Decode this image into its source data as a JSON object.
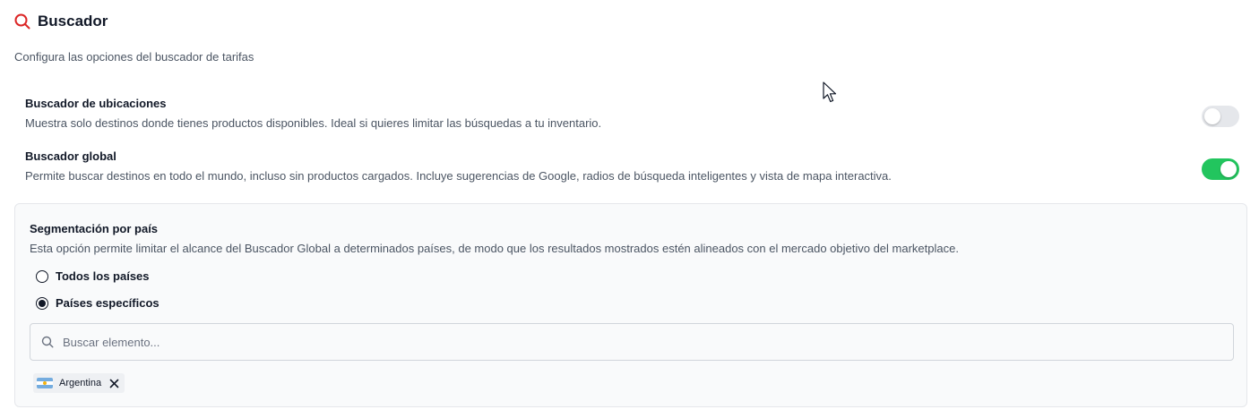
{
  "header": {
    "title": "Buscador",
    "subtitle": "Configura las opciones del buscador de tarifas",
    "icon": "search-icon",
    "accent_color": "#dc2626"
  },
  "settings": [
    {
      "label": "Buscador de ubicaciones",
      "description": "Muestra solo destinos donde tienes productos disponibles. Ideal si quieres limitar las búsquedas a tu inventario.",
      "enabled": false
    },
    {
      "label": "Buscador global",
      "description": "Permite buscar destinos en todo el mundo, incluso sin productos cargados. Incluye sugerencias de Google, radios de búsqueda inteligentes y vista de mapa interactiva.",
      "enabled": true
    }
  ],
  "segmentation": {
    "title": "Segmentación por país",
    "description": "Esta opción permite limitar el alcance del Buscador Global a determinados países, de modo que los resultados mostrados estén alineados con el mercado objetivo del marketplace.",
    "options": [
      {
        "label": "Todos los países",
        "selected": false
      },
      {
        "label": "Países específicos",
        "selected": true
      }
    ],
    "search": {
      "placeholder": "Buscar elemento...",
      "value": ""
    },
    "selected_countries": [
      {
        "name": "Argentina",
        "flag": "argentina-flag-icon"
      }
    ]
  },
  "colors": {
    "toggle_on": "#22c55e",
    "toggle_off": "#e5e7eb",
    "panel_bg": "#f9fafb"
  }
}
